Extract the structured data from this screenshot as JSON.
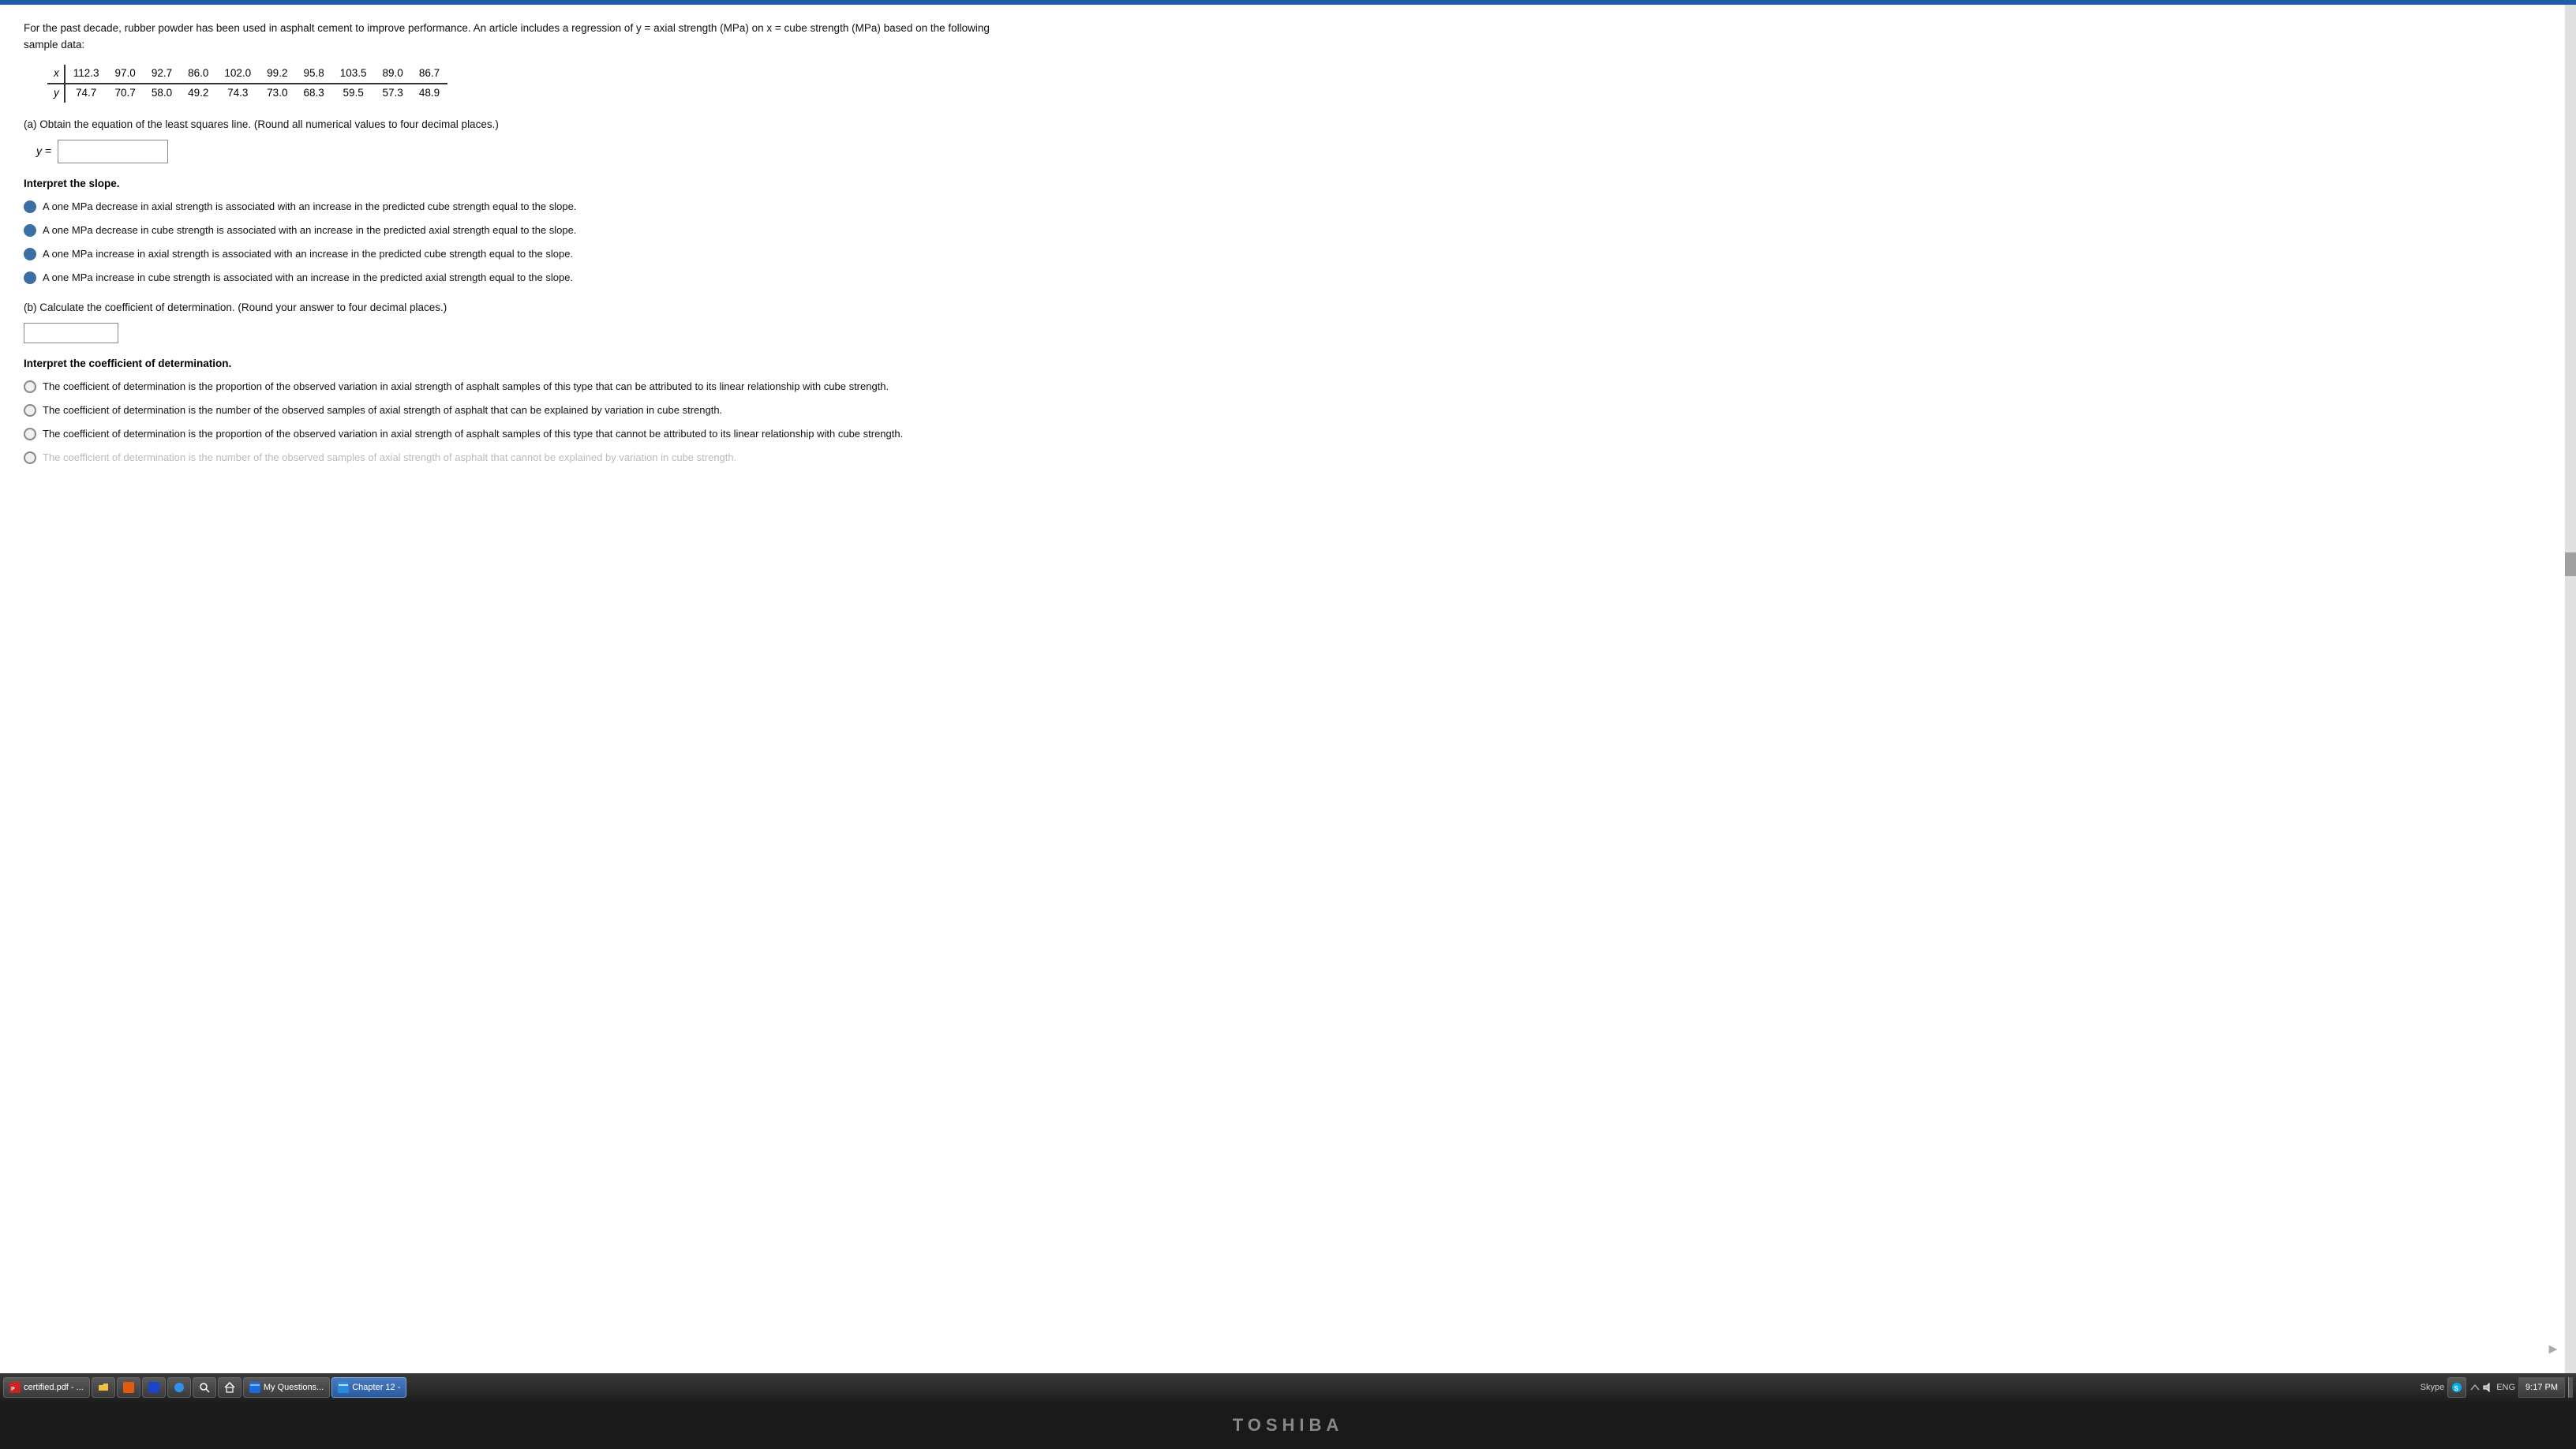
{
  "content": {
    "intro": "For the past decade, rubber powder has been used in asphalt cement to improve performance. An article includes a regression of y = axial strength (MPa) on x = cube strength (MPa) based on the following sample data:",
    "table": {
      "x_label": "x",
      "y_label": "y",
      "x_values": [
        "112.3",
        "97.0",
        "92.7",
        "86.0",
        "102.0",
        "99.2",
        "95.8",
        "103.5",
        "89.0",
        "86.7"
      ],
      "y_values": [
        "74.7",
        "70.7",
        "58.0",
        "49.2",
        "74.3",
        "73.0",
        "68.3",
        "59.5",
        "57.3",
        "48.9"
      ]
    },
    "part_a": {
      "label": "(a) Obtain the equation of the least squares line. (Round all numerical values to four decimal places.)",
      "equation_prefix": "y =",
      "input_placeholder": ""
    },
    "interpret_slope": {
      "heading": "Interpret the slope.",
      "options": [
        "A one MPa decrease in axial strength is associated with an increase in the predicted cube strength equal to the slope.",
        "A one MPa decrease in cube strength is associated with an increase in the predicted axial strength equal to the slope.",
        "A one MPa increase in axial strength is associated with an increase in the predicted cube strength equal to the slope.",
        "A one MPa increase in cube strength is associated with an increase in the predicted axial strength equal to the slope."
      ],
      "selected_index": 3
    },
    "part_b": {
      "label": "(b) Calculate the coefficient of determination. (Round your answer to four decimal places.)",
      "input_placeholder": ""
    },
    "interpret_coeff": {
      "heading": "Interpret the coefficient of determination.",
      "options": [
        "The coefficient of determination is the proportion of the observed variation in axial strength of asphalt samples of this type that can be attributed to its linear relationship with cube strength.",
        "The coefficient of determination is the number of the observed samples of axial strength of asphalt that can be explained by variation in cube strength.",
        "The coefficient of determination is the proportion of the observed variation in axial strength of asphalt samples of this type that cannot be attributed to its linear relationship with cube strength.",
        "The coefficient of determination is the number of the observed samples of axial strength of asphalt that cannot be explained by variation in cube strength."
      ],
      "selected_index": 0
    }
  },
  "taskbar": {
    "buttons": [
      {
        "label": "certified.pdf - ...",
        "icon": "pdf",
        "active": false
      },
      {
        "label": "",
        "icon": "folder",
        "active": false
      },
      {
        "label": "",
        "icon": "app",
        "active": false
      },
      {
        "label": "",
        "icon": "app2",
        "active": false
      },
      {
        "label": "",
        "icon": "app3",
        "active": false
      },
      {
        "label": "",
        "icon": "search",
        "active": false
      },
      {
        "label": "",
        "icon": "home",
        "active": false
      },
      {
        "label": "My Questions...",
        "icon": "browser",
        "active": false
      },
      {
        "label": "Chapter 12 -",
        "icon": "browser2",
        "active": true
      }
    ],
    "systray": {
      "skype_label": "Skype",
      "time": "9:17 PM",
      "lang": "ENG"
    }
  },
  "toshiba": {
    "brand": "TOSHIBA"
  }
}
